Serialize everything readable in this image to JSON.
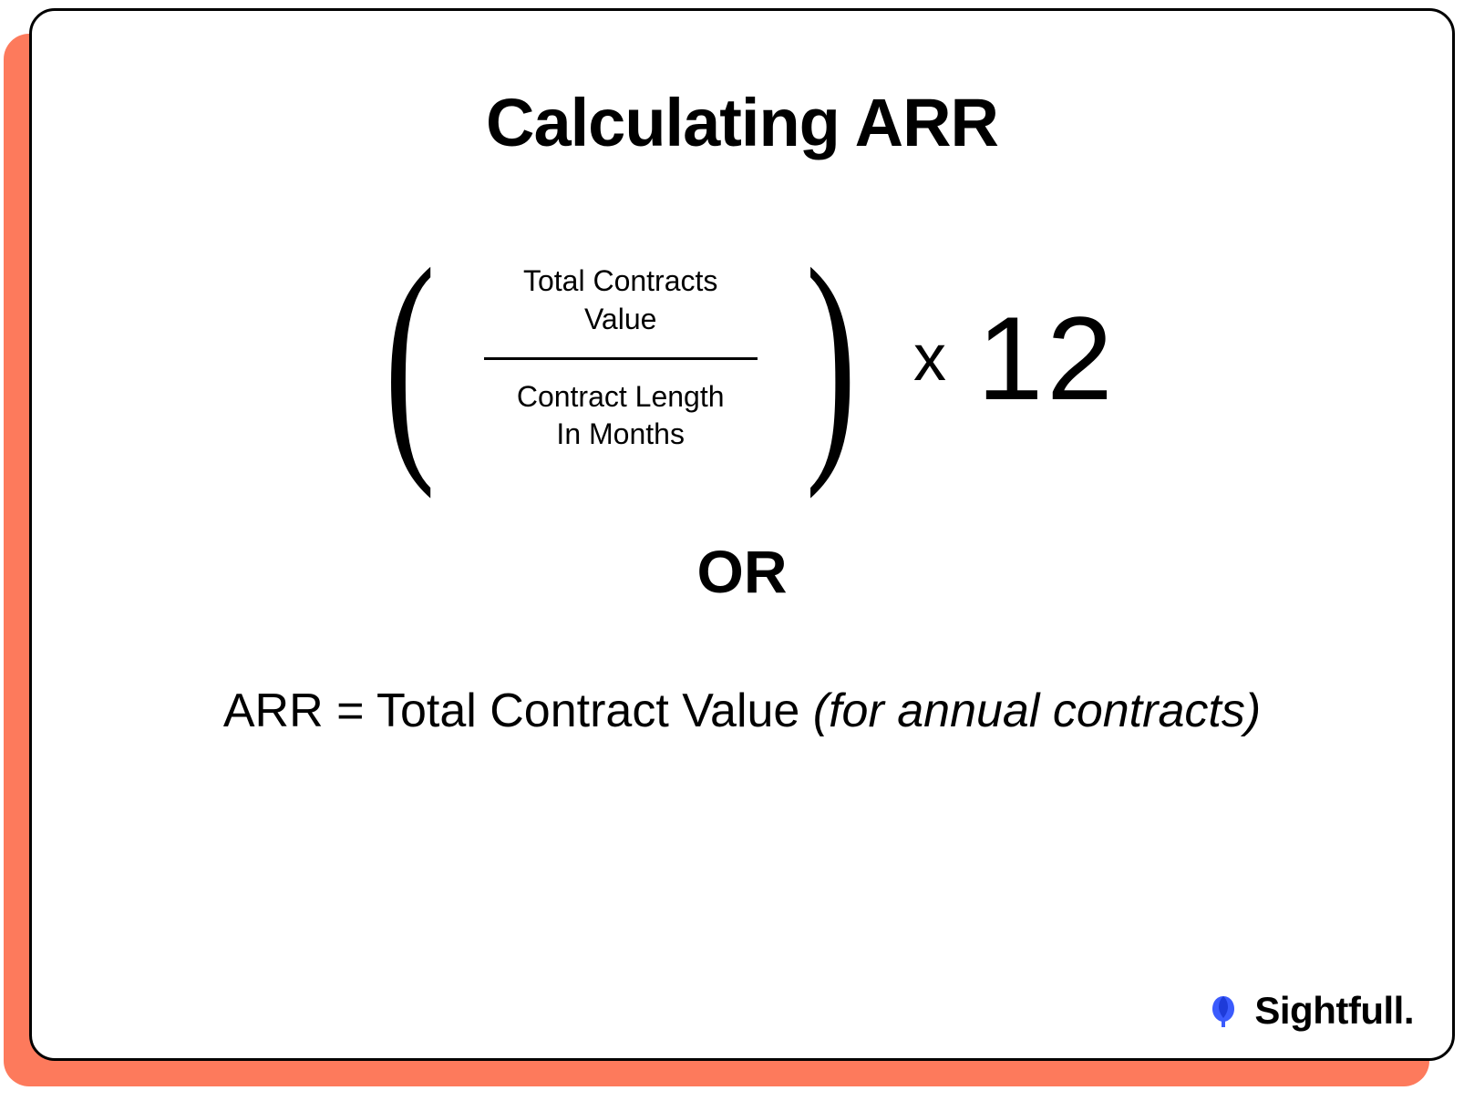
{
  "title": "Calculating ARR",
  "formula": {
    "numerator_line1": "Total Contracts",
    "numerator_line2": "Value",
    "denominator_line1": "Contract Length",
    "denominator_line2": "In Months",
    "multiplier_symbol": "x",
    "multiplier_value": "12"
  },
  "separator": "OR",
  "alt_formula": {
    "prefix": "ARR = Total Contract Value ",
    "suffix_italic": "(for annual contracts)"
  },
  "brand": {
    "name": "Sightfull.",
    "icon_color": "#3b5bfd"
  }
}
